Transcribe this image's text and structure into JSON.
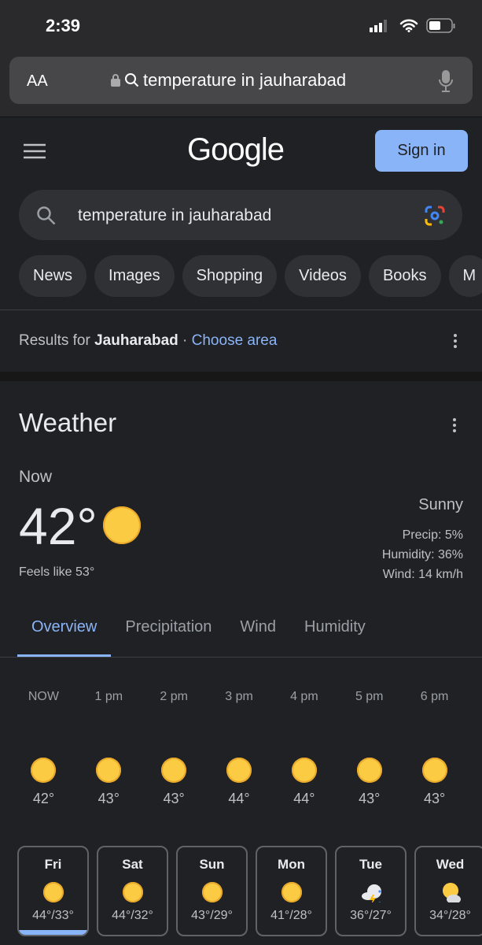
{
  "status": {
    "time": "2:39"
  },
  "browser": {
    "aa": "AA",
    "url": "temperature in jauharabad"
  },
  "header": {
    "logo": "Google",
    "sign_in": "Sign in"
  },
  "search": {
    "query": "temperature in jauharabad"
  },
  "chips": [
    "News",
    "Images",
    "Shopping",
    "Videos",
    "Books",
    "M"
  ],
  "results": {
    "prefix": "Results for ",
    "location": "Jauharabad",
    "sep": " · ",
    "choose": "Choose area"
  },
  "weather": {
    "title": "Weather",
    "now": "Now",
    "temp": "42°",
    "feels": "Feels like 53°",
    "condition": "Sunny",
    "precip": "Precip: 5%",
    "humidity": "Humidity: 36%",
    "wind": "Wind: 14 km/h",
    "tabs": [
      "Overview",
      "Precipitation",
      "Wind",
      "Humidity"
    ],
    "hours": [
      {
        "l": "NOW",
        "t": "42°"
      },
      {
        "l": "1 pm",
        "t": "43°"
      },
      {
        "l": "2 pm",
        "t": "43°"
      },
      {
        "l": "3 pm",
        "t": "44°"
      },
      {
        "l": "4 pm",
        "t": "44°"
      },
      {
        "l": "5 pm",
        "t": "43°"
      },
      {
        "l": "6 pm",
        "t": "43°"
      }
    ],
    "days": [
      {
        "d": "Fri",
        "t": "44°/33°",
        "icon": "sunny"
      },
      {
        "d": "Sat",
        "t": "44°/32°",
        "icon": "sunny"
      },
      {
        "d": "Sun",
        "t": "43°/29°",
        "icon": "sunny"
      },
      {
        "d": "Mon",
        "t": "41°/28°",
        "icon": "sunny"
      },
      {
        "d": "Tue",
        "t": "36°/27°",
        "icon": "thunderstorm"
      },
      {
        "d": "Wed",
        "t": "34°/28°",
        "icon": "partly-cloudy"
      }
    ]
  },
  "colors": {
    "accent": "#8ab4f8",
    "sun": "#fbcb44",
    "bg": "#202124"
  }
}
